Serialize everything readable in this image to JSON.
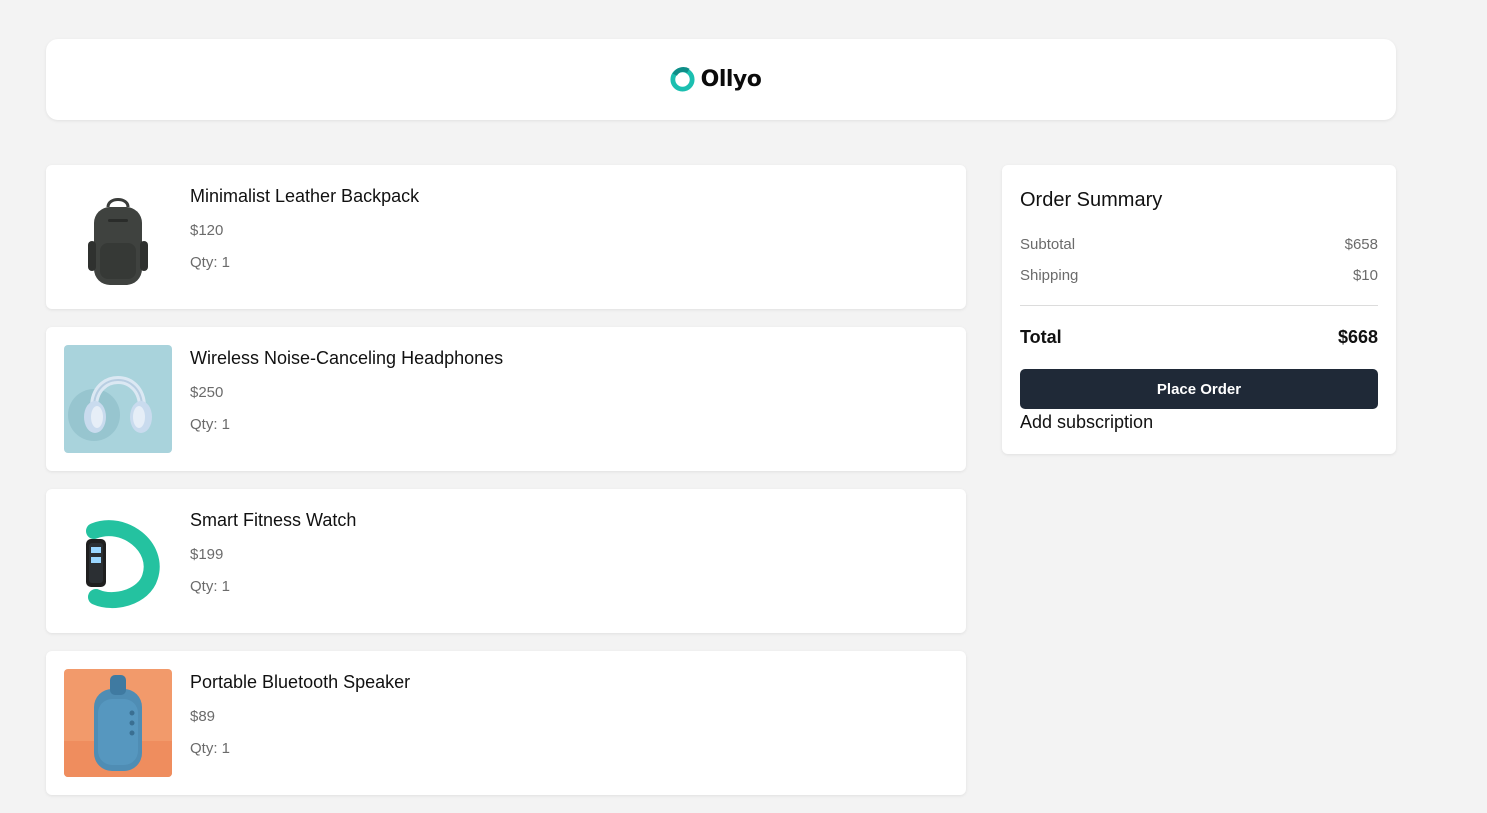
{
  "brand": {
    "name": "Ollyo",
    "accent": "#1bbfb0"
  },
  "cart": {
    "items": [
      {
        "name": "Minimalist Leather Backpack",
        "price": "$120",
        "qty": "Qty: 1",
        "image": "backpack-image"
      },
      {
        "name": "Wireless Noise-Canceling Headphones",
        "price": "$250",
        "qty": "Qty: 1",
        "image": "headphones-image"
      },
      {
        "name": "Smart Fitness Watch",
        "price": "$199",
        "qty": "Qty: 1",
        "image": "fitness-watch-image"
      },
      {
        "name": "Portable Bluetooth Speaker",
        "price": "$89",
        "qty": "Qty: 1",
        "image": "speaker-image"
      }
    ]
  },
  "summary": {
    "title": "Order Summary",
    "subtotal_label": "Subtotal",
    "subtotal_value": "$658",
    "shipping_label": "Shipping",
    "shipping_value": "$10",
    "total_label": "Total",
    "total_value": "$668",
    "place_order_label": "Place Order",
    "add_subscription_label": "Add subscription",
    "button_color": "#1f2937"
  }
}
